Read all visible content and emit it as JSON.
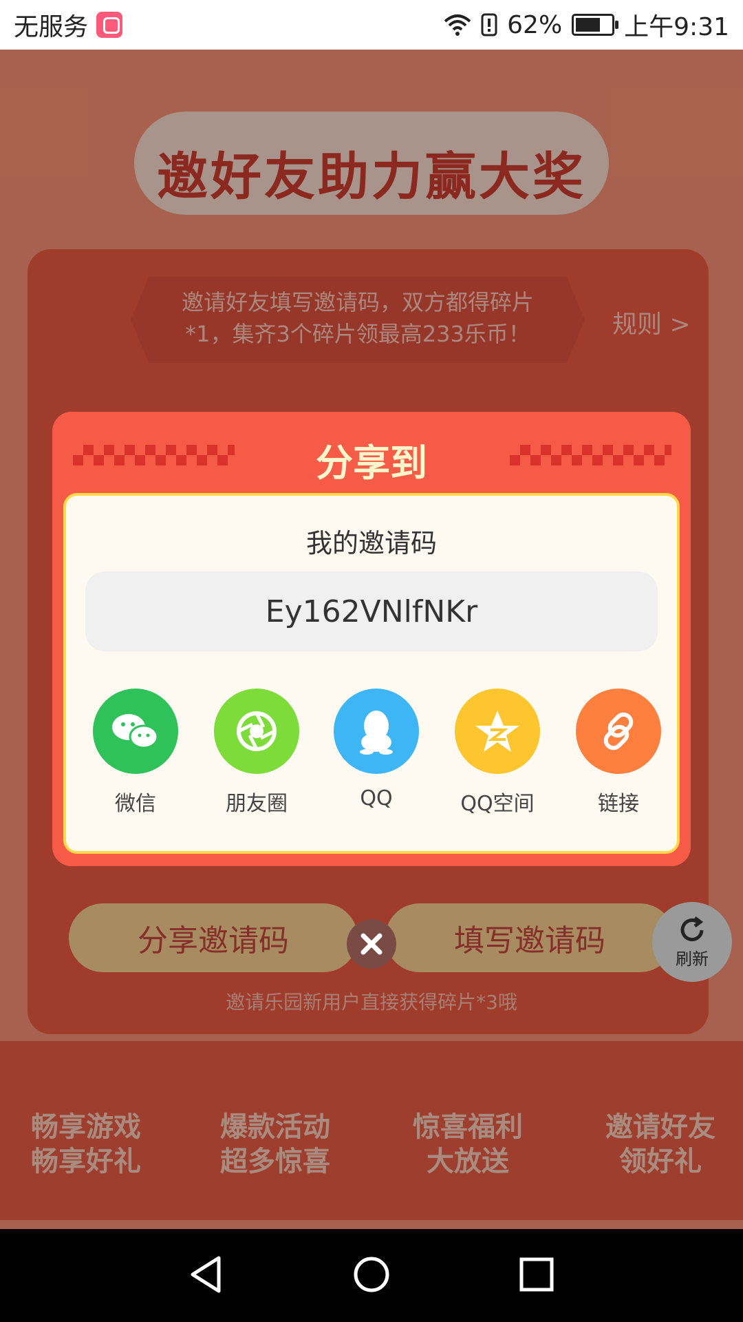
{
  "status_bar": {
    "carrier": "无服务",
    "battery": "62%",
    "time": "上午9:31"
  },
  "background": {
    "banner_title": "邀好友助力赢大奖",
    "rule_text_line1": "邀请好友填写邀请码，双方都得碎片",
    "rule_text_line2": "*1，集齐3个碎片领最高233乐币！",
    "rules_link": "规则 >",
    "share_code_button": "分享邀请码",
    "fill_code_button": "填写邀请码",
    "refresh_label": "刷新",
    "note": "邀请乐园新用户直接获得碎片*3哦",
    "features": [
      {
        "line1": "畅享游戏",
        "line2": "畅享好礼"
      },
      {
        "line1": "爆款活动",
        "line2": "超多惊喜"
      },
      {
        "line1": "惊喜福利",
        "line2": "大放送"
      },
      {
        "line1": "邀请好友",
        "line2": "领好礼"
      }
    ]
  },
  "modal": {
    "title": "分享到",
    "code_label": "我的邀请码",
    "code_value": "Ey162VNlfNKr",
    "share_targets": [
      {
        "label": "微信",
        "icon": "wechat-icon",
        "color": "#2fc25b"
      },
      {
        "label": "朋友圈",
        "icon": "moments-icon",
        "color": "#7ddc3a"
      },
      {
        "label": "QQ",
        "icon": "qq-icon",
        "color": "#3eb6f5"
      },
      {
        "label": "QQ空间",
        "icon": "qzone-icon",
        "color": "#fdc62e"
      },
      {
        "label": "链接",
        "icon": "link-icon",
        "color": "#ff7f3f"
      }
    ]
  }
}
